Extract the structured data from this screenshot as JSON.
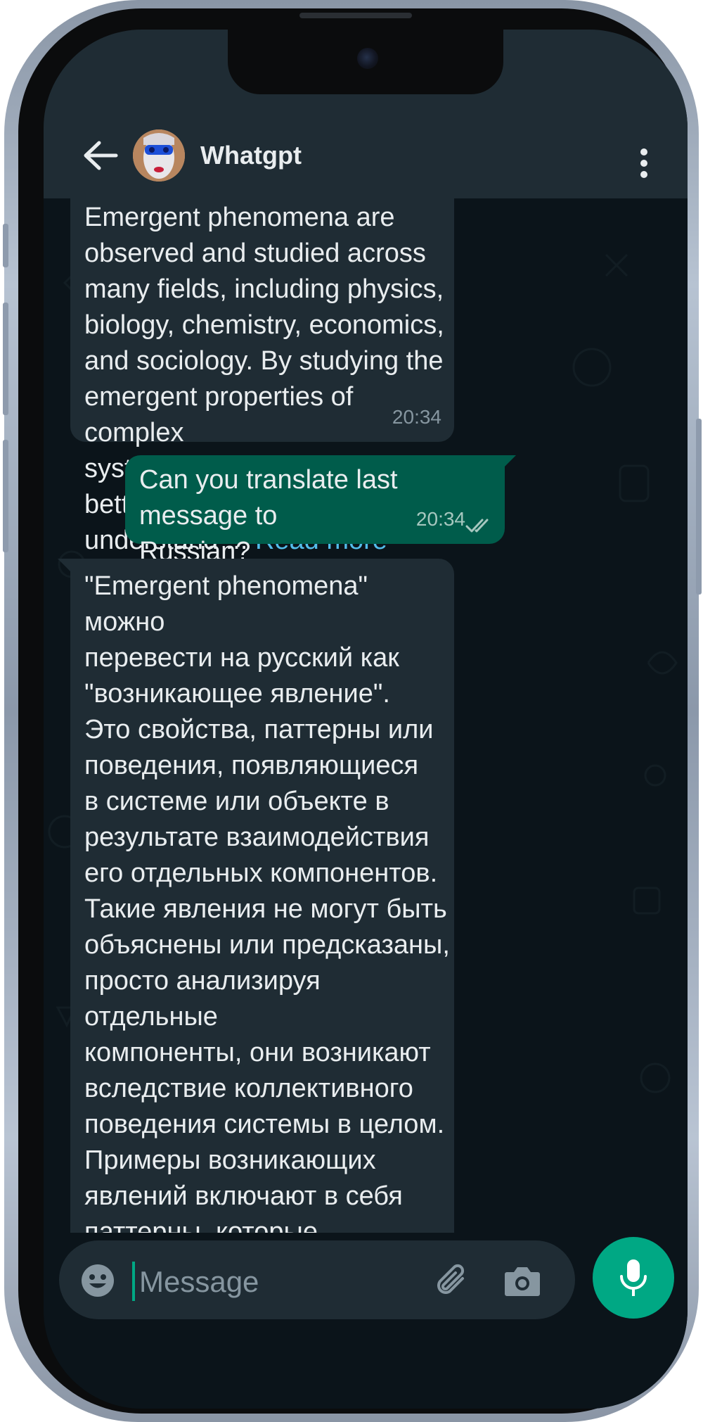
{
  "header": {
    "contact_name": "Whatgpt"
  },
  "messages": [
    {
      "direction": "incoming",
      "text": "Emergent phenomena are\nobserved and studied across\nmany fields, including physics,\nbiology, chemistry, economics,\nand sociology. By studying the\nemergent properties of complex\nsystems, researchers can better\nunderstand ... ",
      "link": "Read more",
      "time": "20:34"
    },
    {
      "direction": "outgoing",
      "text": "Can you translate last message to\nRussian?",
      "time": "20:34",
      "status": "read"
    },
    {
      "direction": "incoming",
      "text": "\"Emergent phenomena\" можно\nперевести на русский как\n\"возникающее явление\".\nЭто свойства, паттерны или\nповедения, появляющиеся\nв системе или объекте в\nрезультате взаимодействия\nего отдельных компонентов.\nТакие явления не могут быть\nобъяснены или предсказаны,\nпросто анализируя отдельные\nкомпоненты, они возникают\nвследствие коллективного\nповедения системы в целом.\nПримеры возникающих\nявлений включают в себя\nпаттерны, которые появляются,"
    }
  ],
  "composer": {
    "placeholder": "Message"
  },
  "icons": {
    "back": "arrow-left-icon",
    "more": "more-vertical-icon",
    "emoji": "emoji-icon",
    "attach": "paperclip-icon",
    "camera": "camera-icon",
    "mic": "mic-icon",
    "read_receipt": "double-check-icon"
  },
  "colors": {
    "header_bg": "#1f2c34",
    "chat_bg": "#0b141a",
    "incoming_bubble": "#1f2c34",
    "outgoing_bubble": "#005c4b",
    "accent": "#00a884",
    "link": "#53bdeb"
  }
}
